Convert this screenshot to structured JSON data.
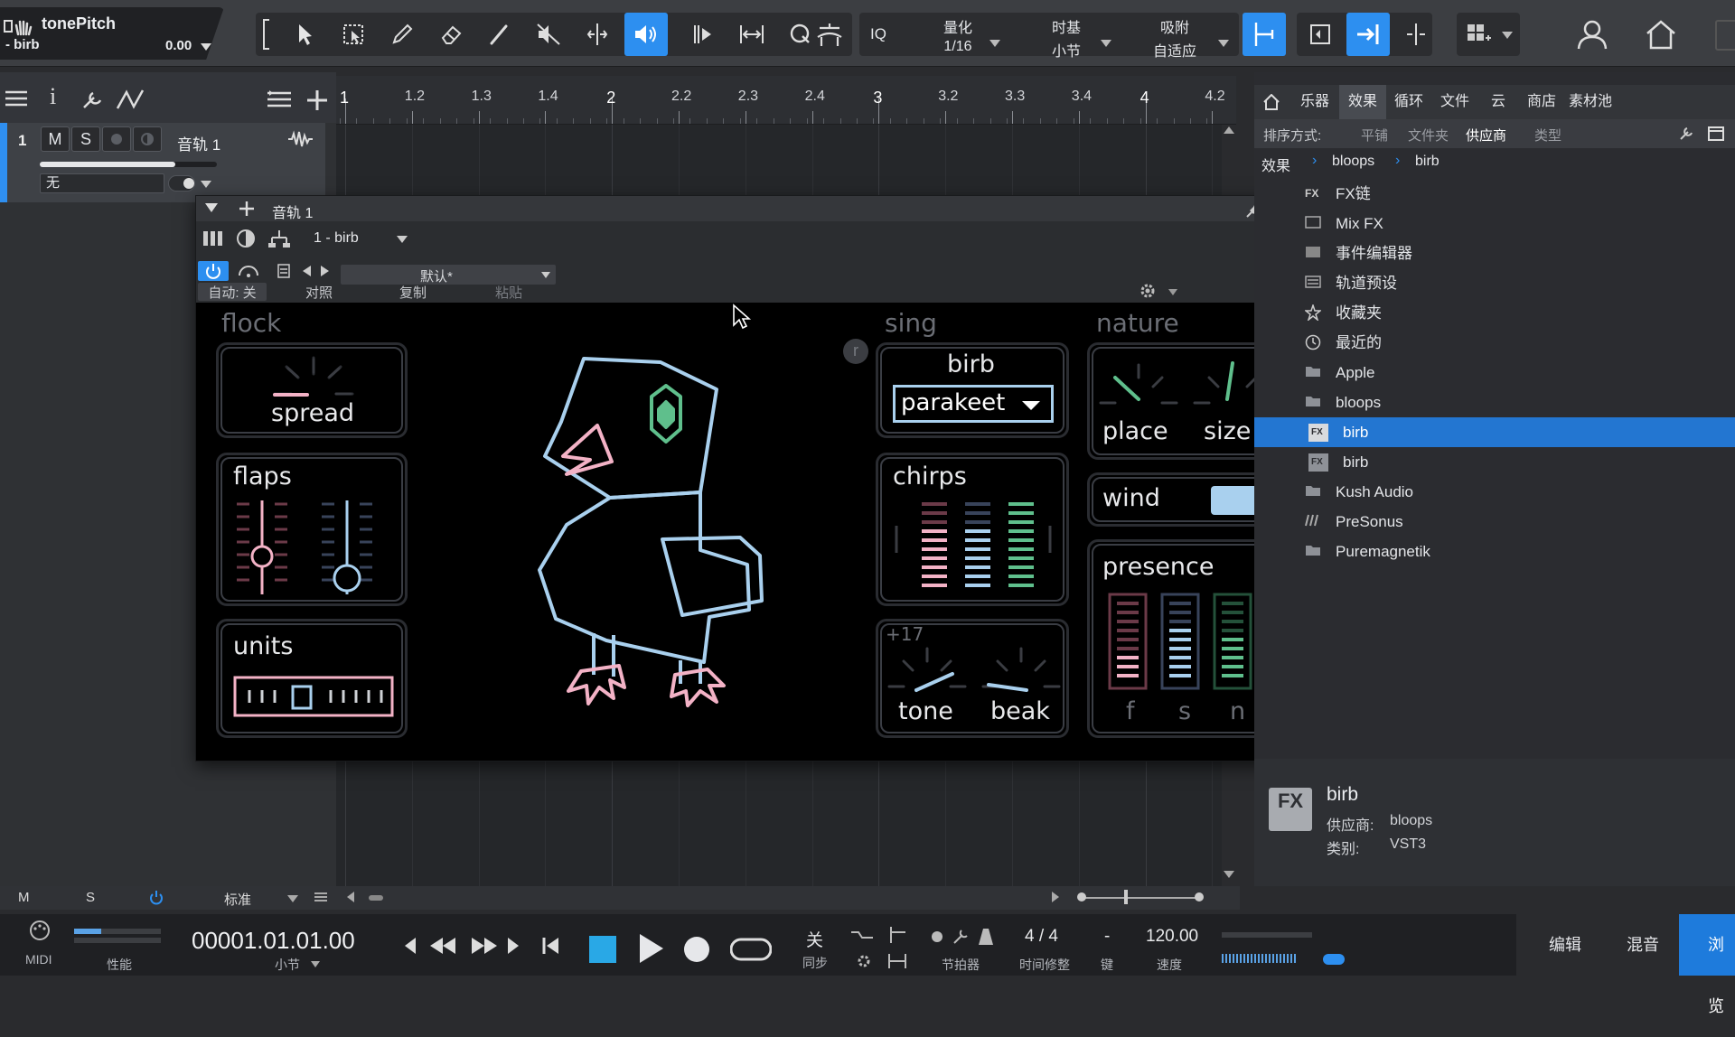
{
  "song": {
    "title": "tonePitch",
    "subtitle": "- birb",
    "value": "0.00"
  },
  "toolbar": {
    "iq_label": "IQ",
    "quantize": {
      "label": "量化",
      "value": "1/16"
    },
    "timebase": {
      "label": "时基",
      "value": "小节"
    },
    "snap": {
      "label": "吸附",
      "value": "自适应"
    }
  },
  "track": {
    "number": "1",
    "mute": "M",
    "solo": "S",
    "name": "音轨 1",
    "input": "无"
  },
  "ruler": {
    "labels": [
      "1",
      "1.2",
      "1.3",
      "1.4",
      "2",
      "2.2",
      "2.3",
      "2.4",
      "3",
      "3.2",
      "3.3",
      "3.4",
      "4",
      "4.2"
    ]
  },
  "plugin": {
    "window_title": "音轨 1",
    "slot": "1 - birb",
    "preset": "默认*",
    "auto": "自动: 关",
    "compare": "对照",
    "copy": "复制",
    "paste": "粘贴",
    "sections": {
      "flock": "flock",
      "sing": "sing",
      "nature": "nature"
    },
    "labels": {
      "spread": "spread",
      "flaps": "flaps",
      "units": "units",
      "birb": "birb",
      "birb_select": "parakeet",
      "chirps": "chirps",
      "tone_offset": "+17",
      "tone": "tone",
      "beak": "beak",
      "place": "place",
      "size": "size",
      "wind": "wind",
      "presence": "presence",
      "f": "f",
      "s": "s",
      "n": "n",
      "reset": "r"
    },
    "colors": {
      "pink": "#f3b2c6",
      "blue": "#a9d0ee",
      "green": "#5fbf8c",
      "outline": "#2a2c31"
    }
  },
  "browser": {
    "tabs": [
      "乐器",
      "效果",
      "循环",
      "文件",
      "云",
      "商店",
      "素材池"
    ],
    "active_tab": "效果",
    "sort_label": "排序方式:",
    "sort_options": [
      "平铺",
      "文件夹",
      "供应商",
      "类型"
    ],
    "sort_active": "供应商",
    "breadcrumb": [
      "效果",
      "bloops",
      "birb"
    ],
    "tree": [
      {
        "icon": "fx-chain-icon",
        "label": "FX链"
      },
      {
        "icon": "mixfx-icon",
        "label": "Mix FX"
      },
      {
        "icon": "event-editor-icon",
        "label": "事件编辑器"
      },
      {
        "icon": "track-preset-icon",
        "label": "轨道预设"
      },
      {
        "icon": "star-icon",
        "label": "收藏夹"
      },
      {
        "icon": "clock-icon",
        "label": "最近的"
      },
      {
        "icon": "folder-icon",
        "label": "Apple"
      },
      {
        "icon": "folder-open-icon",
        "label": "bloops"
      },
      {
        "icon": "fx-vst3-icon",
        "label": "birb",
        "selected": true
      },
      {
        "icon": "fx-au-icon",
        "label": "birb"
      },
      {
        "icon": "folder-icon",
        "label": "Kush Audio"
      },
      {
        "icon": "presonus-icon",
        "label": "PreSonus"
      },
      {
        "icon": "folder-icon",
        "label": "Puremagnetik"
      }
    ],
    "info": {
      "name": "birb",
      "vendor_label": "供应商:",
      "vendor": "bloops",
      "category_label": "类别:",
      "category": "VST3"
    }
  },
  "bottomstrip": {
    "m": "M",
    "s": "S",
    "mode": "标准"
  },
  "transport": {
    "midi": "MIDI",
    "performance": "性能",
    "position": "00001.01.01.00",
    "position_unit": "小节",
    "sync_value": "关",
    "sync_label": "同步",
    "metronome": "节拍器",
    "signature": "4 / 4",
    "timecorrect": "时间修整",
    "key_value": "-",
    "key_label": "键",
    "tempo": "120.00",
    "tempo_label": "速度",
    "pages": [
      "编辑",
      "混音",
      "浏览"
    ]
  }
}
